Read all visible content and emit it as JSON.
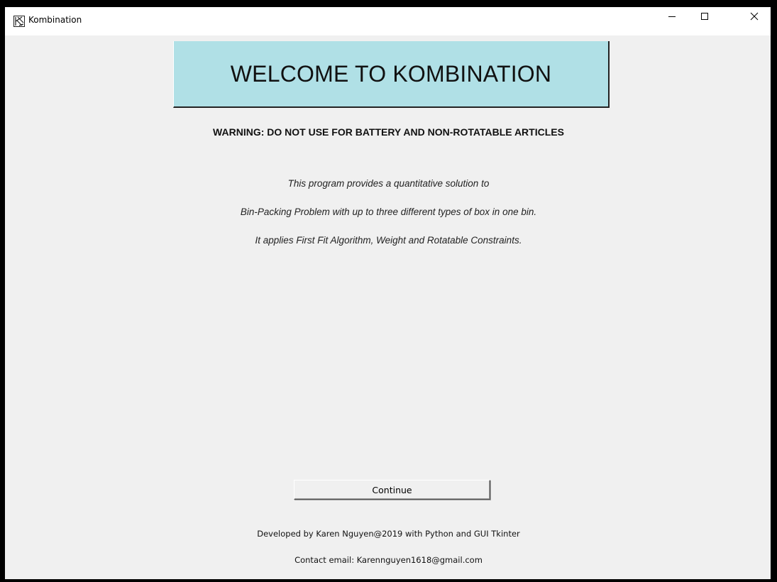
{
  "window": {
    "title": "Kombination",
    "controls": {
      "minimize_icon": "minimize-icon",
      "maximize_icon": "maximize-icon",
      "close_icon": "close-icon"
    }
  },
  "banner": {
    "text": "WELCOME TO KOMBINATION",
    "background_color": "#b0e0e6"
  },
  "warning": "WARNING: DO NOT USE FOR BATTERY AND NON-ROTATABLE ARTICLES",
  "description": {
    "line1": "This program provides a quantitative solution to",
    "line2": "Bin-Packing Problem with up to three different types of box in one bin.",
    "line3": "It applies First Fit Algorithm, Weight and Rotatable Constraints."
  },
  "actions": {
    "continue_label": "Continue"
  },
  "footer": {
    "developer": "Developed by Karen Nguyen@2019 with Python and GUI Tkinter",
    "contact": "Contact email: Karennguyen1618@gmail.com"
  }
}
